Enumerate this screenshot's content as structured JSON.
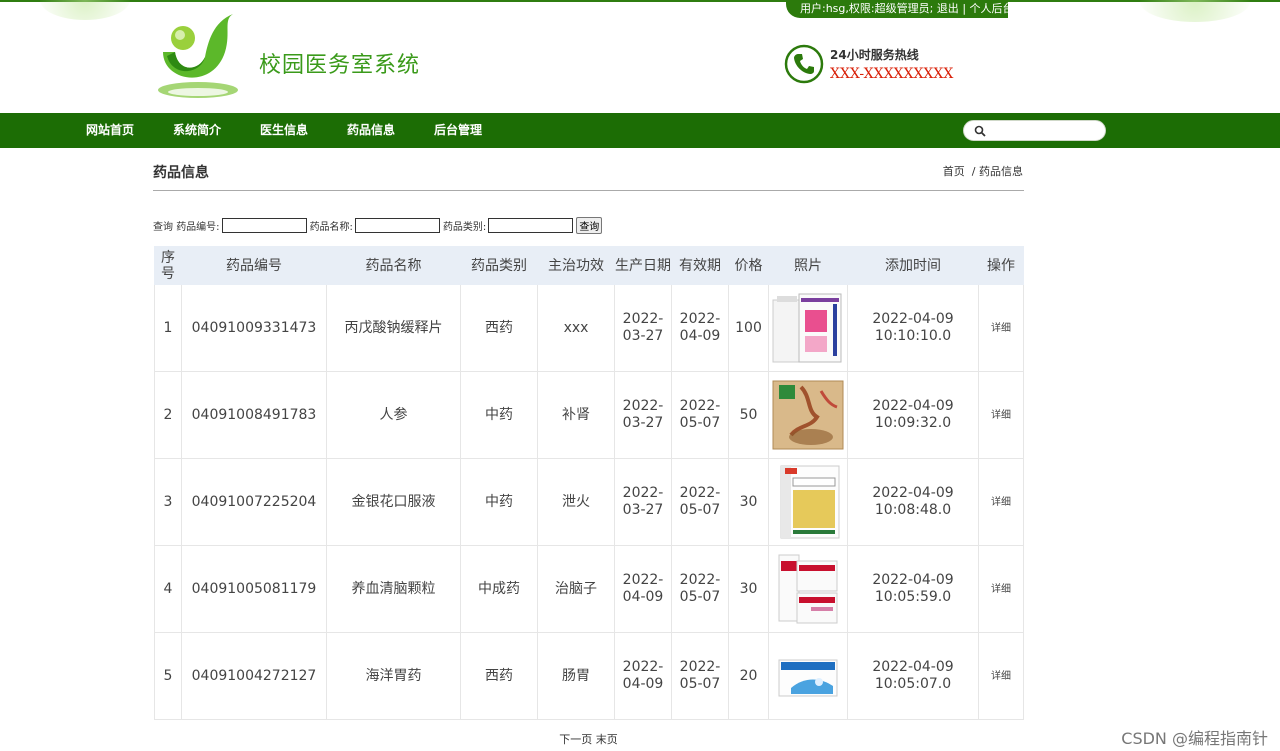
{
  "userbar": {
    "user_info": "用户:hsg,权限:超级管理员;",
    "logout": "退出",
    "separator": "|",
    "admin_link": "个人后台"
  },
  "header": {
    "site_title": "校园医务室系统",
    "hotline_label": "24小时服务热线",
    "hotline_number": "XXX-XXXXXXXXX"
  },
  "nav": {
    "items": [
      "网站首页",
      "系统简介",
      "医生信息",
      "药品信息",
      "后台管理"
    ]
  },
  "search": {
    "value": ""
  },
  "page": {
    "heading": "药品信息",
    "breadcrumb_home": "首页",
    "breadcrumb_sep": "/",
    "breadcrumb_current": "药品信息"
  },
  "filter": {
    "query_label": "查询",
    "code_label": "药品编号:",
    "name_label": "药品名称:",
    "type_label": "药品类别:",
    "submit_label": "查询"
  },
  "table": {
    "headers": [
      "序号",
      "药品编号",
      "药品名称",
      "药品类别",
      "主治功效",
      "生产日期",
      "有效期",
      "价格",
      "照片",
      "添加时间",
      "操作"
    ],
    "rows": [
      {
        "index": "1",
        "code": "04091009331473",
        "name": "丙戊酸钠缓释片",
        "category": "西药",
        "effect": "xxx",
        "produced": "2022-03-27",
        "expiry": "2022-04-09",
        "price": "100",
        "photo": "pill-box-white-pink",
        "added": "2022-04-09 10:10:10.0",
        "action": "详细"
      },
      {
        "index": "2",
        "code": "04091008491783",
        "name": "人参",
        "category": "中药",
        "effect": "补肾",
        "produced": "2022-03-27",
        "expiry": "2022-05-07",
        "price": "50",
        "photo": "ginseng-gift-box",
        "added": "2022-04-09 10:09:32.0",
        "action": "详细"
      },
      {
        "index": "3",
        "code": "04091007225204",
        "name": "金银花口服液",
        "category": "中药",
        "effect": "泄火",
        "produced": "2022-03-27",
        "expiry": "2022-05-07",
        "price": "30",
        "photo": "oral-liquid-box",
        "added": "2022-04-09 10:08:48.0",
        "action": "详细"
      },
      {
        "index": "4",
        "code": "04091005081179",
        "name": "养血清脑颗粒",
        "category": "中成药",
        "effect": "治脑子",
        "produced": "2022-04-09",
        "expiry": "2022-05-07",
        "price": "30",
        "photo": "granule-boxes-red",
        "added": "2022-04-09 10:05:59.0",
        "action": "详细"
      },
      {
        "index": "5",
        "code": "04091004272127",
        "name": "海洋胃药",
        "category": "西药",
        "effect": "肠胃",
        "produced": "2022-04-09",
        "expiry": "2022-05-07",
        "price": "20",
        "photo": "stomach-medicine-blue",
        "added": "2022-04-09 10:05:07.0",
        "action": "详细"
      }
    ]
  },
  "pager": {
    "next": "下一页",
    "last": "末页"
  },
  "watermark": "CSDN @编程指南针",
  "colors": {
    "nav": "#1c6d05",
    "brand_green": "#3a9a1a",
    "hotline_red": "#d81e06",
    "table_header": "#e8eef6"
  }
}
